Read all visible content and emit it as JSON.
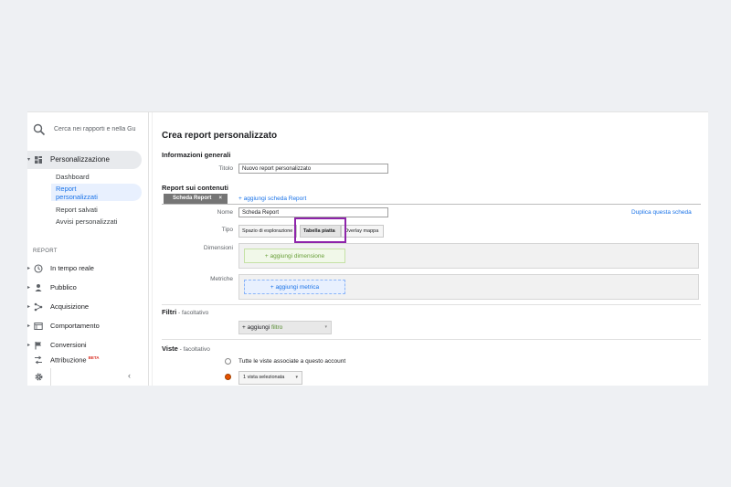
{
  "sidebar": {
    "search_placeholder": "Cerca nei rapporti e nella Gu",
    "personalization_label": "Personalizzazione",
    "sub_items": [
      {
        "label": "Dashboard"
      },
      {
        "label": "Report personalizzati"
      },
      {
        "label": "Report salvati"
      },
      {
        "label": "Avvisi personalizzati"
      }
    ],
    "section_label": "REPORT",
    "nav_items": [
      {
        "label": "In tempo reale",
        "icon": "clock-icon"
      },
      {
        "label": "Pubblico",
        "icon": "person-icon"
      },
      {
        "label": "Acquisizione",
        "icon": "acquisition-icon"
      },
      {
        "label": "Comportamento",
        "icon": "behavior-icon"
      },
      {
        "label": "Conversioni",
        "icon": "flag-icon"
      },
      {
        "label": "Attribuzione",
        "icon": "attribution-icon",
        "badge": "BETA"
      }
    ]
  },
  "main": {
    "title": "Crea report personalizzato",
    "general": {
      "heading": "Informazioni generali",
      "title_label": "Titolo",
      "title_value": "Nuovo report personalizzato"
    },
    "content": {
      "heading": "Report sui contenuti",
      "tab_label": "Scheda Report",
      "tab_close": "×",
      "add_tab_link": "+ aggiungi scheda Report",
      "duplicate_link": "Duplica questa scheda",
      "name_label": "Nome",
      "name_value": "Scheda Report",
      "type_label": "Tipo",
      "type_options": [
        "Spazio di esplorazione",
        "Tabella piatta",
        "Overlay mappa"
      ],
      "selected_type": "Tabella piatta",
      "dimensions_label": "Dimensioni",
      "add_dimension": "+ aggiungi dimensione",
      "metrics_label": "Metriche",
      "add_metric": "+ aggiungi metrica"
    },
    "filters": {
      "heading": "Filtri",
      "optional": " - facoltativo",
      "add_prefix": "+ aggiungi ",
      "add_word": "filtro"
    },
    "views": {
      "heading": "Viste",
      "optional": " - facoltativo",
      "all_views": "Tutte le viste associate a questo account",
      "selected_views": "1 vista selezionata"
    }
  },
  "colors": {
    "accent": "#1a73e8",
    "highlight": "#8e24aa",
    "radio_selected": "#e65100"
  }
}
